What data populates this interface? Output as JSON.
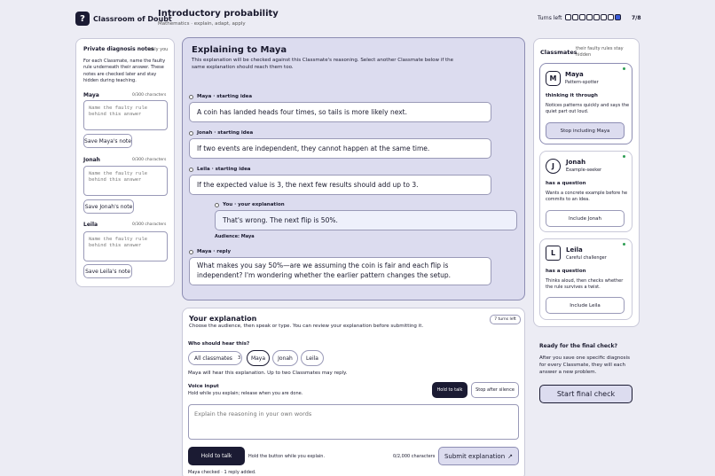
{
  "header": {
    "logo_glyph": "?",
    "classroom": "Classroom of Doubt",
    "title": "Introductory probability",
    "subtitle": "Mathematics · explain, adapt, apply",
    "turns_label": "Turns left",
    "turns_value": "7/8",
    "turns_total": 8,
    "turns_filled": 1
  },
  "left_panel": {
    "title": "Private diagnosis notes",
    "only_you": "only you",
    "description": "For each Classmate, name the faulty rule underneath their answer. These notes are checked later and stay hidden during teaching.",
    "classmates": [
      {
        "name": "Maya",
        "count": "0/300 characters",
        "placeholder": "Name the faulty rule behind this answer",
        "save": "Save Maya's note"
      },
      {
        "name": "Jonah",
        "count": "0/300 characters",
        "placeholder": "Name the faulty rule behind this answer",
        "save": "Save Jonah's note"
      },
      {
        "name": "Leila",
        "count": "0/300 characters",
        "placeholder": "Name the faulty rule behind this answer",
        "save": "Save Leila's note"
      }
    ]
  },
  "explain_panel": {
    "title": "Explaining to Maya",
    "description": "This explanation will be checked against this Classmate's reasoning. Select another Classmate below if the same explanation should reach them too.",
    "entries": [
      {
        "meta": "Maya · starting idea",
        "text": "A coin has landed heads four times, so tails is more likely next."
      },
      {
        "meta": "Jonah · starting idea",
        "text": "If two events are independent, they cannot happen at the same time."
      },
      {
        "meta": "Leila · starting idea",
        "text": "If the expected value is 3, the next few results should add up to 3."
      },
      {
        "meta": "You · your explanation",
        "text": "That's wrong. The next flip is 50%.",
        "audience": "Audience: Maya"
      },
      {
        "meta": "Maya · reply",
        "text": "What makes you say 50%—are we assuming the coin is fair and each flip is independent? I'm wondering whether the earlier pattern changes the setup."
      }
    ]
  },
  "your_explanation": {
    "title": "Your explanation",
    "description": "Choose the audience, then speak or type. You can review your explanation before submitting it.",
    "turns_badge": "7 turns left",
    "who_label": "Who should hear this?",
    "all_classmates": "All classmates",
    "all_count": "3",
    "chips": [
      "Maya",
      "Jonah",
      "Leila"
    ],
    "hear_note": "Maya will hear this explanation. Up to two Classmates may reply.",
    "voice_title": "Voice input",
    "voice_desc": "Hold while you explain; release when you are done.",
    "hold_talk": "Hold to talk",
    "stop_silence": "Stop after silence",
    "textarea_placeholder": "Explain the reasoning in your own words",
    "hold_talk_large": "Hold to talk",
    "hold_hint": "Hold the button while you explain.",
    "char_count": "0/2,000 characters",
    "submit": "Submit explanation",
    "checked_note": "Maya checked · 1 reply added."
  },
  "classmates_panel": {
    "title": "Classmates",
    "note": "their faulty rules stay hidden",
    "maya": {
      "initial": "M",
      "name": "Maya",
      "role": "Pattern-spotter",
      "status": "thinking it through",
      "description": "Notices patterns quickly and says the quiet part out loud.",
      "button": "Stop including Maya"
    },
    "jonah": {
      "initial": "J",
      "name": "Jonah",
      "role": "Example-seeker",
      "question": "has a question",
      "description": "Wants a concrete example before he commits to an idea.",
      "button": "Include Jonah"
    },
    "leila": {
      "initial": "L",
      "name": "Leila",
      "role": "Careful challenger",
      "question": "has a question",
      "description": "Thinks aloud, then checks whether the rule survives a twist.",
      "button": "Include Leila"
    }
  },
  "final": {
    "title": "Ready for the final check?",
    "description": "After you save one specific diagnosis for every Classmate, they will each answer a new problem.",
    "button": "Start final check"
  },
  "colors": {
    "accent": "#3a5bd9",
    "dark": "#1b1b33",
    "tint": "#dcdcef",
    "online": "#2f9e55"
  }
}
